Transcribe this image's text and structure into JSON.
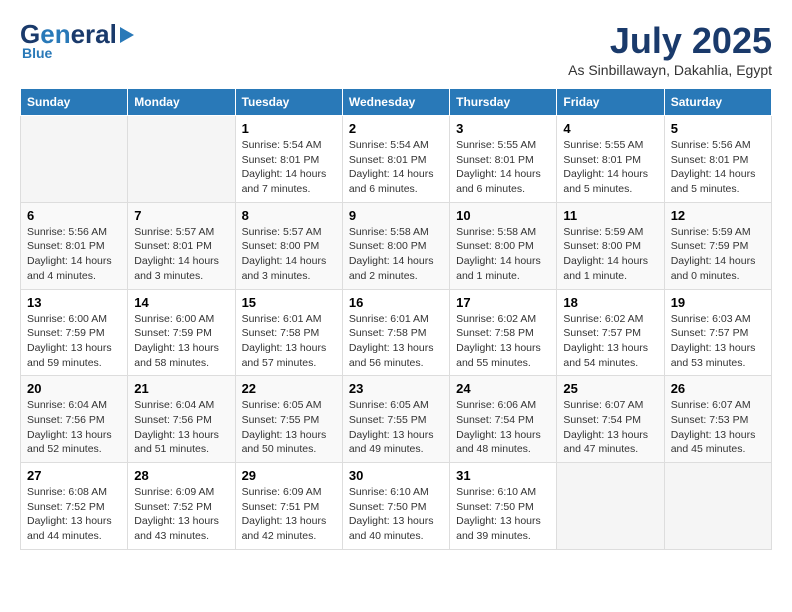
{
  "logo": {
    "part1": "General",
    "part2": "Blue"
  },
  "title": "July 2025",
  "location": "As Sinbillawayn, Dakahlia, Egypt",
  "weekdays": [
    "Sunday",
    "Monday",
    "Tuesday",
    "Wednesday",
    "Thursday",
    "Friday",
    "Saturday"
  ],
  "weeks": [
    [
      {
        "day": "",
        "info": ""
      },
      {
        "day": "",
        "info": ""
      },
      {
        "day": "1",
        "info": "Sunrise: 5:54 AM\nSunset: 8:01 PM\nDaylight: 14 hours\nand 7 minutes."
      },
      {
        "day": "2",
        "info": "Sunrise: 5:54 AM\nSunset: 8:01 PM\nDaylight: 14 hours\nand 6 minutes."
      },
      {
        "day": "3",
        "info": "Sunrise: 5:55 AM\nSunset: 8:01 PM\nDaylight: 14 hours\nand 6 minutes."
      },
      {
        "day": "4",
        "info": "Sunrise: 5:55 AM\nSunset: 8:01 PM\nDaylight: 14 hours\nand 5 minutes."
      },
      {
        "day": "5",
        "info": "Sunrise: 5:56 AM\nSunset: 8:01 PM\nDaylight: 14 hours\nand 5 minutes."
      }
    ],
    [
      {
        "day": "6",
        "info": "Sunrise: 5:56 AM\nSunset: 8:01 PM\nDaylight: 14 hours\nand 4 minutes."
      },
      {
        "day": "7",
        "info": "Sunrise: 5:57 AM\nSunset: 8:01 PM\nDaylight: 14 hours\nand 3 minutes."
      },
      {
        "day": "8",
        "info": "Sunrise: 5:57 AM\nSunset: 8:00 PM\nDaylight: 14 hours\nand 3 minutes."
      },
      {
        "day": "9",
        "info": "Sunrise: 5:58 AM\nSunset: 8:00 PM\nDaylight: 14 hours\nand 2 minutes."
      },
      {
        "day": "10",
        "info": "Sunrise: 5:58 AM\nSunset: 8:00 PM\nDaylight: 14 hours\nand 1 minute."
      },
      {
        "day": "11",
        "info": "Sunrise: 5:59 AM\nSunset: 8:00 PM\nDaylight: 14 hours\nand 1 minute."
      },
      {
        "day": "12",
        "info": "Sunrise: 5:59 AM\nSunset: 7:59 PM\nDaylight: 14 hours\nand 0 minutes."
      }
    ],
    [
      {
        "day": "13",
        "info": "Sunrise: 6:00 AM\nSunset: 7:59 PM\nDaylight: 13 hours\nand 59 minutes."
      },
      {
        "day": "14",
        "info": "Sunrise: 6:00 AM\nSunset: 7:59 PM\nDaylight: 13 hours\nand 58 minutes."
      },
      {
        "day": "15",
        "info": "Sunrise: 6:01 AM\nSunset: 7:58 PM\nDaylight: 13 hours\nand 57 minutes."
      },
      {
        "day": "16",
        "info": "Sunrise: 6:01 AM\nSunset: 7:58 PM\nDaylight: 13 hours\nand 56 minutes."
      },
      {
        "day": "17",
        "info": "Sunrise: 6:02 AM\nSunset: 7:58 PM\nDaylight: 13 hours\nand 55 minutes."
      },
      {
        "day": "18",
        "info": "Sunrise: 6:02 AM\nSunset: 7:57 PM\nDaylight: 13 hours\nand 54 minutes."
      },
      {
        "day": "19",
        "info": "Sunrise: 6:03 AM\nSunset: 7:57 PM\nDaylight: 13 hours\nand 53 minutes."
      }
    ],
    [
      {
        "day": "20",
        "info": "Sunrise: 6:04 AM\nSunset: 7:56 PM\nDaylight: 13 hours\nand 52 minutes."
      },
      {
        "day": "21",
        "info": "Sunrise: 6:04 AM\nSunset: 7:56 PM\nDaylight: 13 hours\nand 51 minutes."
      },
      {
        "day": "22",
        "info": "Sunrise: 6:05 AM\nSunset: 7:55 PM\nDaylight: 13 hours\nand 50 minutes."
      },
      {
        "day": "23",
        "info": "Sunrise: 6:05 AM\nSunset: 7:55 PM\nDaylight: 13 hours\nand 49 minutes."
      },
      {
        "day": "24",
        "info": "Sunrise: 6:06 AM\nSunset: 7:54 PM\nDaylight: 13 hours\nand 48 minutes."
      },
      {
        "day": "25",
        "info": "Sunrise: 6:07 AM\nSunset: 7:54 PM\nDaylight: 13 hours\nand 47 minutes."
      },
      {
        "day": "26",
        "info": "Sunrise: 6:07 AM\nSunset: 7:53 PM\nDaylight: 13 hours\nand 45 minutes."
      }
    ],
    [
      {
        "day": "27",
        "info": "Sunrise: 6:08 AM\nSunset: 7:52 PM\nDaylight: 13 hours\nand 44 minutes."
      },
      {
        "day": "28",
        "info": "Sunrise: 6:09 AM\nSunset: 7:52 PM\nDaylight: 13 hours\nand 43 minutes."
      },
      {
        "day": "29",
        "info": "Sunrise: 6:09 AM\nSunset: 7:51 PM\nDaylight: 13 hours\nand 42 minutes."
      },
      {
        "day": "30",
        "info": "Sunrise: 6:10 AM\nSunset: 7:50 PM\nDaylight: 13 hours\nand 40 minutes."
      },
      {
        "day": "31",
        "info": "Sunrise: 6:10 AM\nSunset: 7:50 PM\nDaylight: 13 hours\nand 39 minutes."
      },
      {
        "day": "",
        "info": ""
      },
      {
        "day": "",
        "info": ""
      }
    ]
  ]
}
